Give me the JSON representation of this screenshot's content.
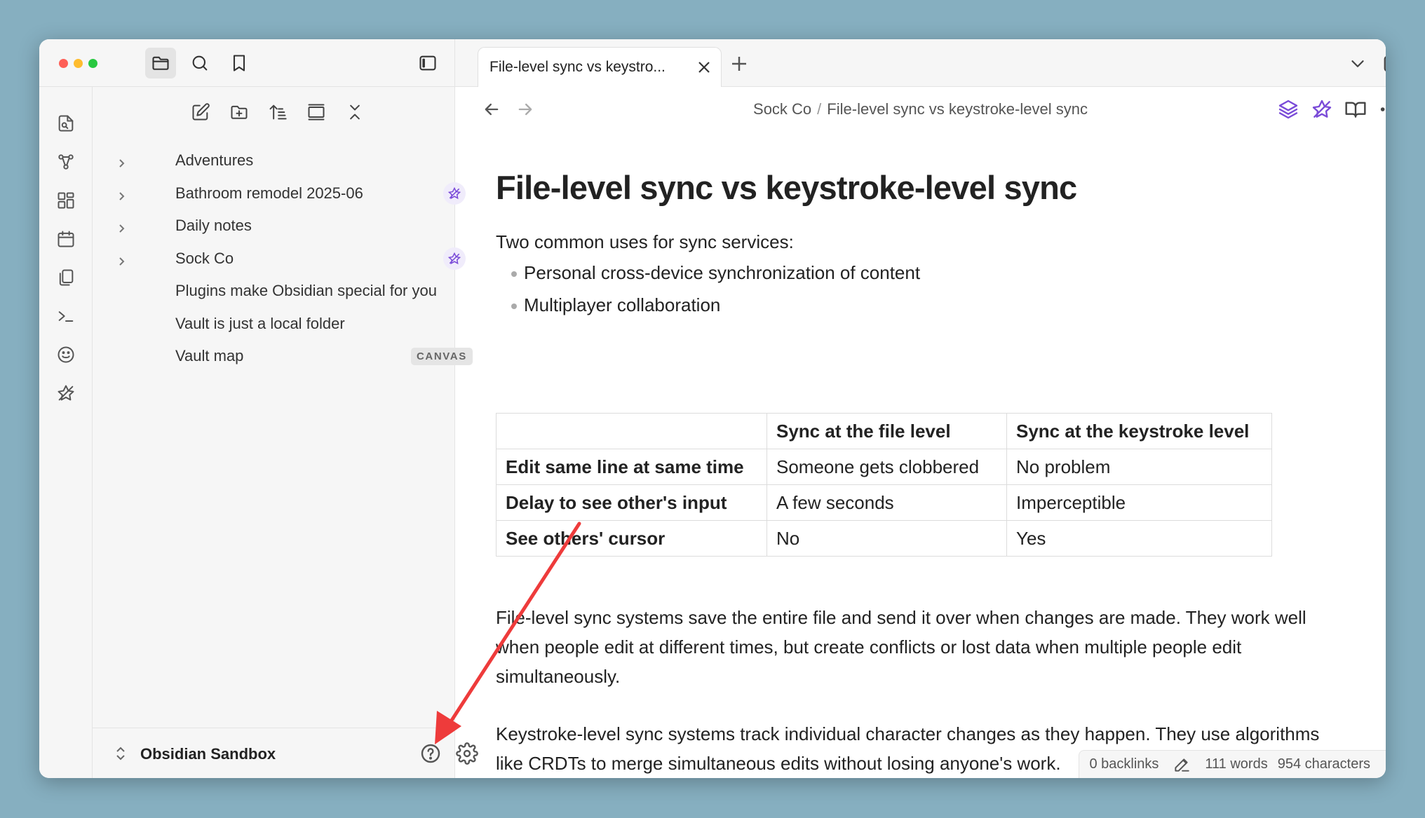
{
  "colors": {
    "accent": "#7a4bd8",
    "annotation_arrow": "#ee3b3b",
    "traffic_red": "#fe5f57",
    "traffic_yellow": "#febc2e",
    "traffic_green": "#28c840"
  },
  "toolbar": {
    "icons": [
      "folder-icon",
      "search-icon",
      "bookmark-icon",
      "sidebar-toggle-icon"
    ]
  },
  "ribbon": {
    "icons": [
      "quick-switcher-icon",
      "graph-icon",
      "canvas-icon",
      "calendar-icon",
      "files-icon",
      "terminal-icon",
      "smiley-icon",
      "sync-icon"
    ]
  },
  "file_nav": {
    "icons": [
      "new-note-icon",
      "new-folder-icon",
      "sort-icon",
      "collapse-pane-icon",
      "collapse-all-icon"
    ]
  },
  "tree": [
    {
      "label": "Adventures",
      "folder": true,
      "synced": false,
      "badge": ""
    },
    {
      "label": "Bathroom remodel 2025-06",
      "folder": true,
      "synced": true,
      "badge": ""
    },
    {
      "label": "Daily notes",
      "folder": true,
      "synced": false,
      "badge": ""
    },
    {
      "label": "Sock Co",
      "folder": true,
      "synced": true,
      "badge": ""
    },
    {
      "label": "Plugins make Obsidian special for you",
      "folder": false,
      "synced": false,
      "badge": ""
    },
    {
      "label": "Vault is just a local folder",
      "folder": false,
      "synced": false,
      "badge": ""
    },
    {
      "label": "Vault map",
      "folder": false,
      "synced": false,
      "badge": "CANVAS"
    }
  ],
  "vault": {
    "name": "Obsidian Sandbox"
  },
  "tab": {
    "title": "File-level sync vs keystro..."
  },
  "breadcrumb": {
    "folder": "Sock Co",
    "separator": "/",
    "note": "File-level sync vs keystroke-level sync"
  },
  "note": {
    "title": "File-level sync vs keystroke-level sync",
    "intro": "Two common uses for sync services:",
    "bullets": [
      "Personal cross-device synchronization of content",
      "Multiplayer collaboration"
    ],
    "table": {
      "headers": [
        "",
        "Sync at the file level",
        "Sync at the keystroke level"
      ],
      "rows": [
        [
          "Edit same line at same time",
          "Someone gets clobbered",
          "No problem"
        ],
        [
          "Delay to see other's input",
          "A few seconds",
          "Imperceptible"
        ],
        [
          "See others' cursor",
          "No",
          "Yes"
        ]
      ]
    },
    "paragraphs": [
      "File-level sync systems save the entire file and send it over when changes are made. They work well when people edit at different times, but create conflicts or lost data when multiple people edit simultaneously.",
      "Keystroke-level sync systems track individual character changes as they happen. They use algorithms like CRDTs to merge simultaneous edits without losing anyone's work."
    ]
  },
  "status": {
    "backlinks": "0 backlinks",
    "words": "111 words",
    "characters": "954 characters"
  }
}
